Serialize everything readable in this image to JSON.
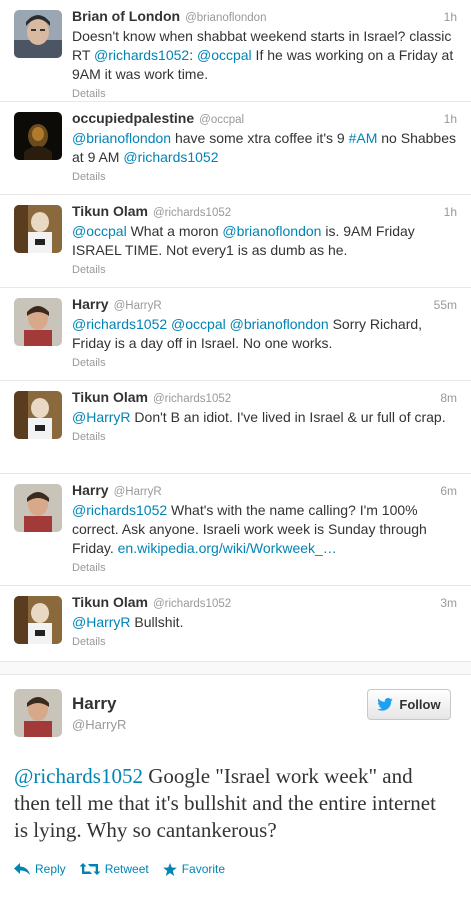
{
  "tweets": [
    {
      "name": "Brian of London",
      "handle": "@brianoflondon",
      "time": "1h",
      "segments": [
        {
          "t": "Doesn't know when shabbat weekend starts in Israel? classic RT "
        },
        {
          "t": "@richards1052",
          "link": true
        },
        {
          "t": ": "
        },
        {
          "t": "@occpal",
          "link": true
        },
        {
          "t": " If he was working on a Friday at 9AM it was work time."
        }
      ],
      "details": "Details"
    },
    {
      "name": "occupiedpalestine",
      "handle": "@occpal",
      "time": "1h",
      "segments": [
        {
          "t": "@brianoflondon",
          "link": true
        },
        {
          "t": " have some xtra coffee it's 9 "
        },
        {
          "t": "#AM",
          "link": true
        },
        {
          "t": " no Shabbes at 9 AM "
        },
        {
          "t": "@richards1052",
          "link": true
        }
      ],
      "details": "Details"
    },
    {
      "name": "Tikun Olam",
      "handle": "@richards1052",
      "time": "1h",
      "segments": [
        {
          "t": "@occpal",
          "link": true
        },
        {
          "t": " What a moron "
        },
        {
          "t": "@brianoflondon",
          "link": true
        },
        {
          "t": " is. 9AM Friday ISRAEL TIME. Not every1 is as dumb as he."
        }
      ],
      "details": "Details"
    },
    {
      "name": "Harry",
      "handle": "@HarryR",
      "time": "55m",
      "segments": [
        {
          "t": "@richards1052",
          "link": true
        },
        {
          "t": " "
        },
        {
          "t": "@occpal",
          "link": true
        },
        {
          "t": " "
        },
        {
          "t": "@brianoflondon",
          "link": true
        },
        {
          "t": " Sorry Richard, Friday is a day off in Israel. No one works."
        }
      ],
      "details": "Details"
    },
    {
      "name": "Tikun Olam",
      "handle": "@richards1052",
      "time": "8m",
      "segments": [
        {
          "t": "@HarryR",
          "link": true
        },
        {
          "t": " Don't B an idiot. I've lived in Israel & ur full of crap."
        }
      ],
      "details": "Details"
    },
    {
      "name": "Harry",
      "handle": "@HarryR",
      "time": "6m",
      "segments": [
        {
          "t": "@richards1052",
          "link": true
        },
        {
          "t": " What's with the name calling? I'm 100% correct. Ask anyone. Israeli work week is Sunday through Friday. "
        },
        {
          "t": "en.wikipedia.org/wiki/Workweek_…",
          "link": true
        }
      ],
      "details": "Details"
    },
    {
      "name": "Tikun Olam",
      "handle": "@richards1052",
      "time": "3m",
      "segments": [
        {
          "t": "@HarryR",
          "link": true
        },
        {
          "t": " Bullshit."
        }
      ],
      "details": "Details"
    }
  ],
  "main_tweet": {
    "name": "Harry",
    "handle": "@HarryR",
    "follow_label": "Follow",
    "segments": [
      {
        "t": "@richards1052",
        "link": true
      },
      {
        "t": " Google \"Israel work week\" and then tell me that it's bullshit and the entire internet is lying. Why so cantankerous?"
      }
    ],
    "actions": {
      "reply": "Reply",
      "retweet": "Retweet",
      "favorite": "Favorite"
    }
  },
  "avatar_styles": [
    "brian",
    "occupied",
    "tikun",
    "harry",
    "tikun",
    "harry",
    "tikun"
  ],
  "colors": {
    "link": "#0084b4",
    "twitter_blue": "#1da1f2",
    "muted": "#999999"
  }
}
